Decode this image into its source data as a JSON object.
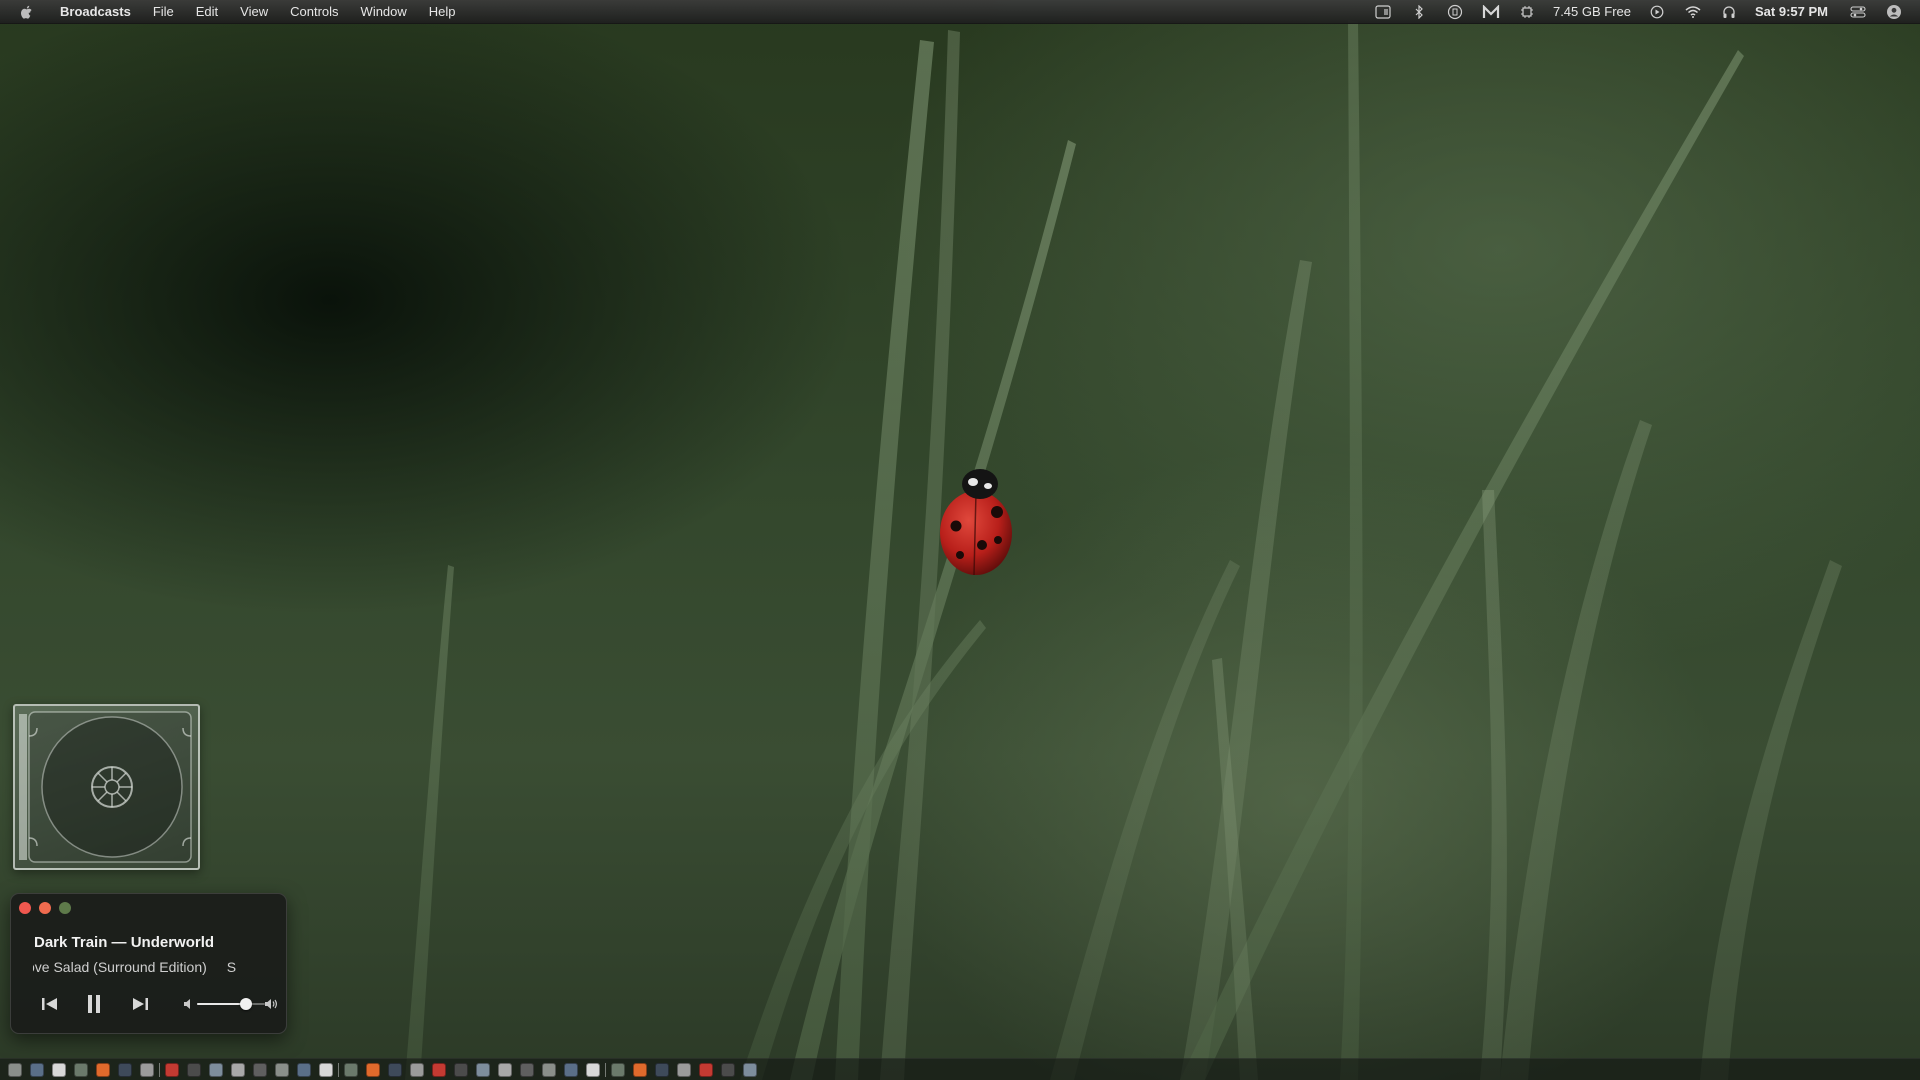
{
  "menubar": {
    "app_name": "Broadcasts",
    "items": [
      "File",
      "Edit",
      "View",
      "Controls",
      "Window",
      "Help"
    ],
    "disk_free": "7.45 GB Free",
    "clock": "Sat 9:57 PM",
    "status_icons": [
      "screen-icon",
      "bluetooth-icon",
      "circle-badge-icon",
      "m-logo-icon",
      "chip-icon",
      "play-circle-icon",
      "wifi-icon",
      "headphones-icon",
      "control-center-icon",
      "user-icon"
    ]
  },
  "player": {
    "track": "Dark Train — Underworld",
    "station": "ove Salad (Surround Edition)",
    "station_next": "S",
    "volume": 0.72,
    "controls": [
      "previous-icon",
      "pause-icon",
      "next-icon"
    ]
  },
  "artwork": {
    "icon": "cd-case-icon"
  },
  "colors": {
    "close": "#f0584f",
    "minimize": "#f06b4f",
    "zoom": "#5e7a4a",
    "ladybug": "#c4241f"
  },
  "dock": {
    "item_count": 34
  }
}
